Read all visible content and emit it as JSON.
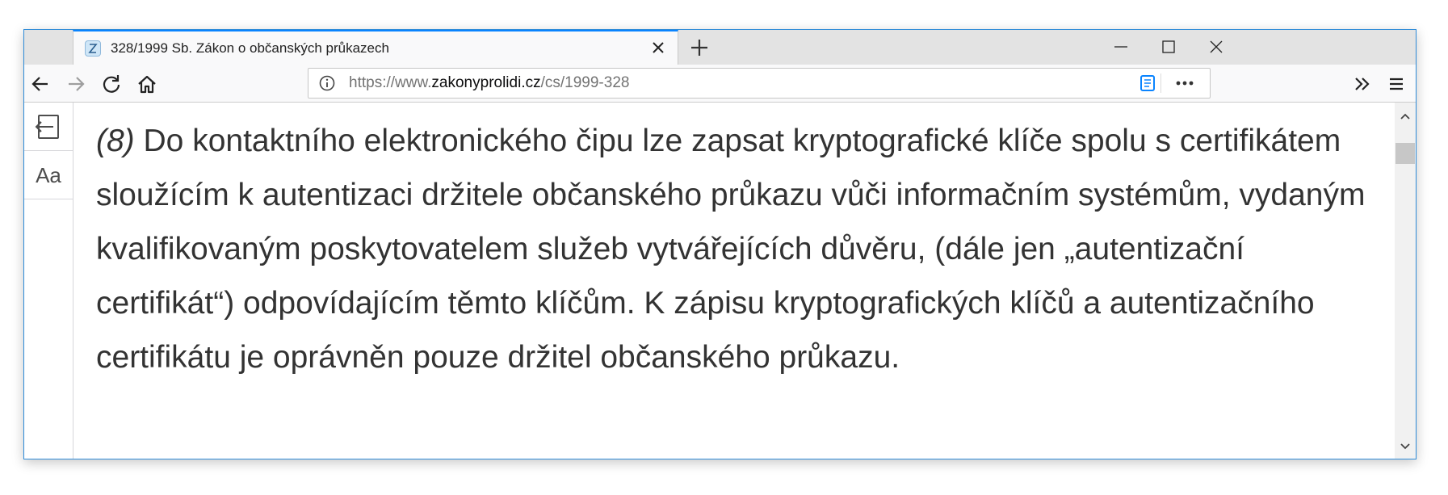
{
  "tab": {
    "title": "328/1999 Sb. Zákon o občanských průkazech",
    "favicon": "zakonyprolidi-favicon"
  },
  "url": {
    "prefix": "https://www.",
    "domain": "zakonyprolidi.cz",
    "path": "/cs/1999-328"
  },
  "reader": {
    "text_size_label": "Aa"
  },
  "article": {
    "paragraph_number": "(8)",
    "paragraph_text": " Do kontaktního elektronického čipu lze zapsat kryptografické klíče spolu s certifikátem sloužícím k autentizaci držitele občanského průkazu vůči informačním systémům, vydaným kvalifikovaným poskytovatelem služeb vytvářejících důvěru, (dále jen „autentizační certifikát“) odpovídajícím těmto klíčům. K zápisu kryptografických klíčů a autentizačního certifikátu je oprávněn pouze držitel občanského průkazu."
  },
  "colors": {
    "accent": "#0a84ff",
    "window_border": "#2e8bd8",
    "text": "#333333"
  },
  "icons": [
    "back-icon",
    "forward-icon",
    "reload-icon",
    "home-icon",
    "info-icon",
    "reader-view-icon",
    "page-actions-icon",
    "overflow-icon",
    "menu-icon",
    "close-reader-icon",
    "new-tab-icon",
    "tab-close-icon",
    "minimize-icon",
    "maximize-icon",
    "close-window-icon"
  ]
}
